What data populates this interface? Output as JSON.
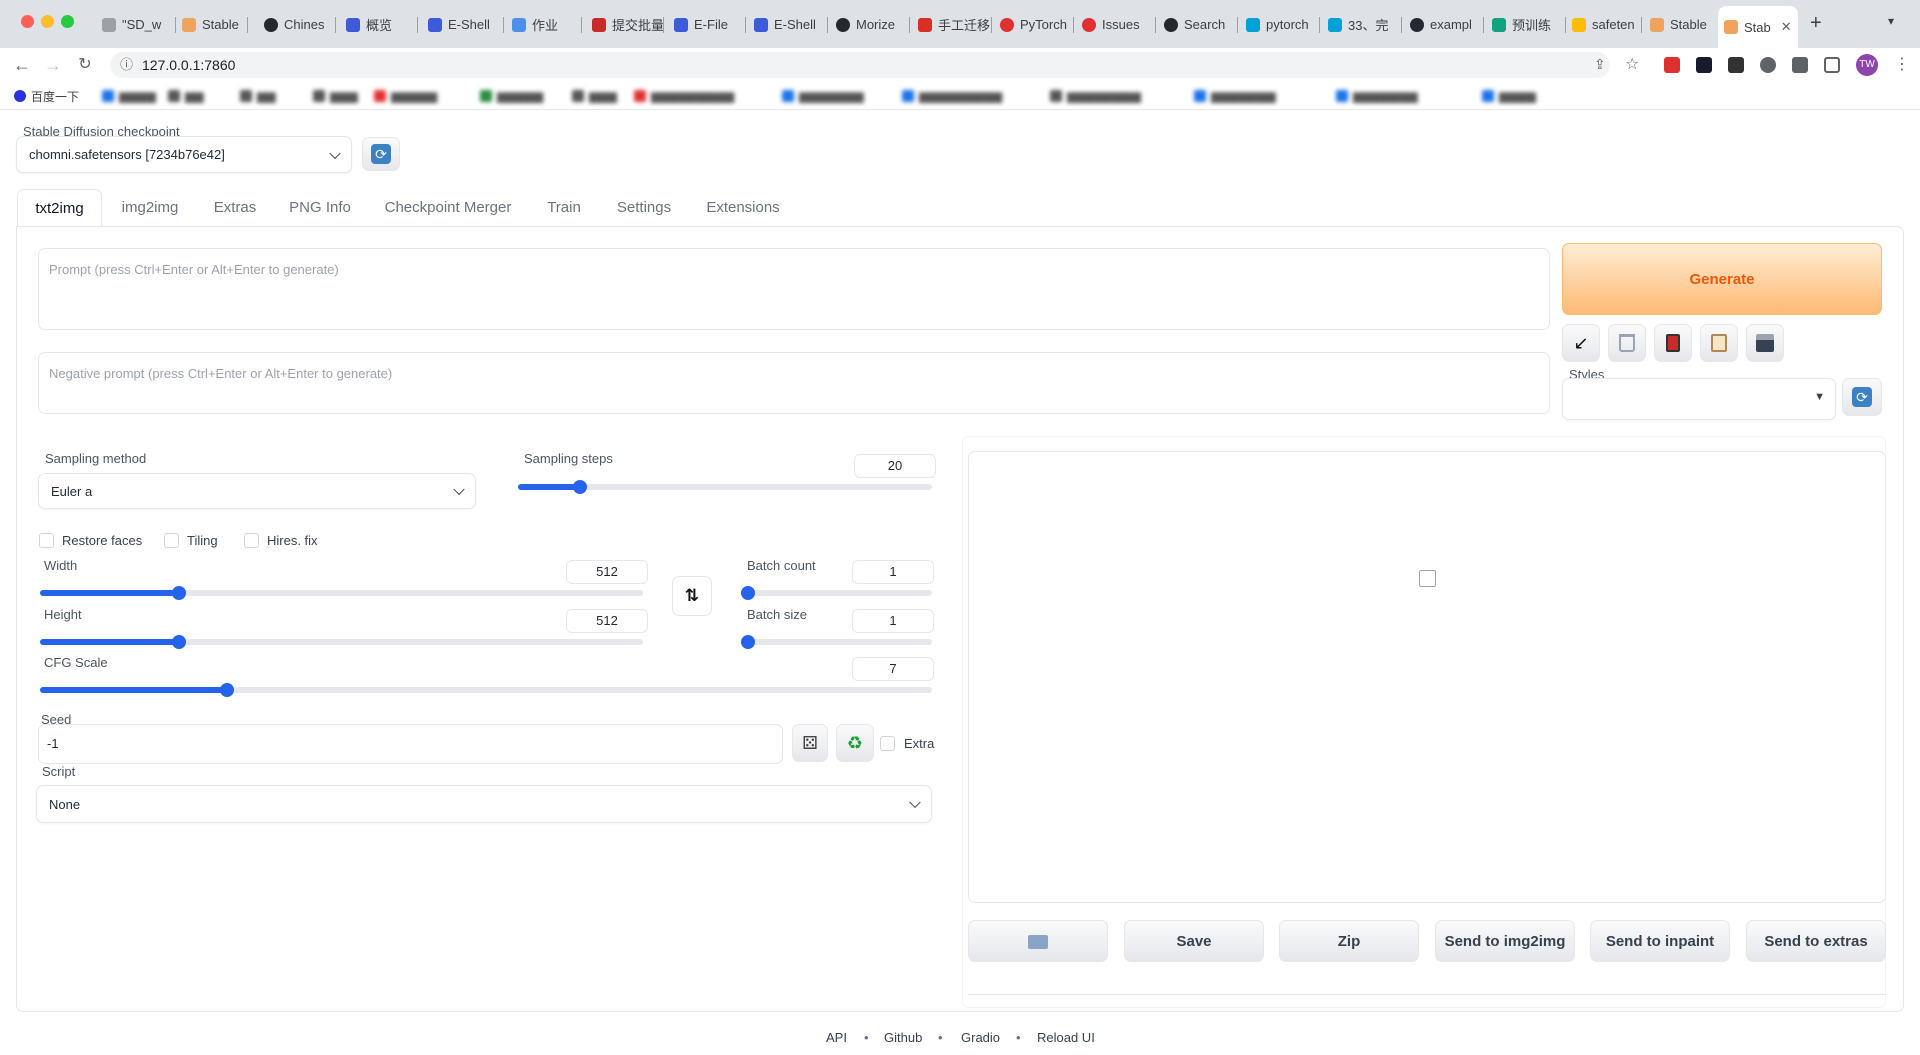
{
  "browser": {
    "tabs": [
      {
        "label": "\"SD_w"
      },
      {
        "label": "Stable"
      },
      {
        "label": "Chines"
      },
      {
        "label": "概览"
      },
      {
        "label": "E-Shell"
      },
      {
        "label": "作业"
      },
      {
        "label": "提交批量"
      },
      {
        "label": "E-File"
      },
      {
        "label": "E-Shell"
      },
      {
        "label": "Morize"
      },
      {
        "label": "手工迁移"
      },
      {
        "label": "PyTorch"
      },
      {
        "label": "Issues"
      },
      {
        "label": "Search"
      },
      {
        "label": "pytorch"
      },
      {
        "label": "33、完"
      },
      {
        "label": "exampl"
      },
      {
        "label": "预训练"
      },
      {
        "label": "safeten"
      },
      {
        "label": "Stable"
      },
      {
        "label": "Stab"
      }
    ],
    "url": "127.0.0.1:7860",
    "profile": "TW",
    "bookmarks": [
      "百度一下"
    ]
  },
  "checkpoint": {
    "label": "Stable Diffusion checkpoint",
    "value": "chomni.safetensors [7234b76e42]"
  },
  "tabs": [
    "txt2img",
    "img2img",
    "Extras",
    "PNG Info",
    "Checkpoint Merger",
    "Train",
    "Settings",
    "Extensions"
  ],
  "prompt": {
    "placeholder": "Prompt (press Ctrl+Enter or Alt+Enter to generate)",
    "negative_placeholder": "Negative prompt (press Ctrl+Enter or Alt+Enter to generate)"
  },
  "generate_label": "Generate",
  "styles_label": "Styles",
  "sampling": {
    "method_label": "Sampling method",
    "method_value": "Euler a",
    "steps_label": "Sampling steps",
    "steps_value": "20",
    "steps_fraction": 0.15
  },
  "checkboxes": {
    "restore_faces": "Restore faces",
    "tiling": "Tiling",
    "hires_fix": "Hires. fix",
    "extra": "Extra"
  },
  "width": {
    "label": "Width",
    "value": "512",
    "fraction": 0.23
  },
  "height": {
    "label": "Height",
    "value": "512",
    "fraction": 0.23
  },
  "batch_count": {
    "label": "Batch count",
    "value": "1",
    "fraction": 0.0
  },
  "batch_size": {
    "label": "Batch size",
    "value": "1",
    "fraction": 0.0
  },
  "cfg": {
    "label": "CFG Scale",
    "value": "7",
    "fraction": 0.21
  },
  "seed": {
    "label": "Seed",
    "value": "-1"
  },
  "script": {
    "label": "Script",
    "value": "None"
  },
  "output_buttons": [
    "Save",
    "Zip",
    "Send to img2img",
    "Send to inpaint",
    "Send to extras"
  ],
  "footer": [
    "API",
    "Github",
    "Gradio",
    "Reload UI"
  ],
  "colors": {
    "accent": "#2563eb",
    "generate_text": "#ea580c",
    "generate_bg": "#fed7aa"
  }
}
